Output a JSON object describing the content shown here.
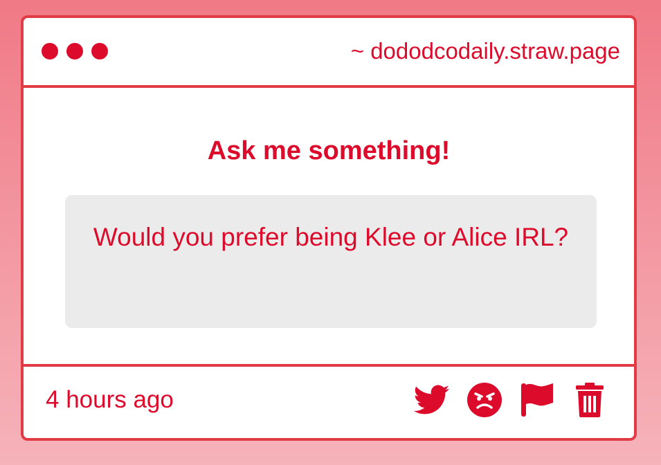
{
  "window": {
    "url": "~ dododcodaily.straw.page",
    "accent_color": "#dd0b2b",
    "border_color": "#e13b46"
  },
  "main": {
    "heading": "Ask me something!",
    "question": "Would you prefer being Klee or Alice IRL?"
  },
  "footer": {
    "timestamp": "4 hours ago",
    "actions": [
      {
        "icon": "twitter-icon"
      },
      {
        "icon": "angry-face-icon"
      },
      {
        "icon": "flag-icon"
      },
      {
        "icon": "trash-icon"
      }
    ]
  }
}
